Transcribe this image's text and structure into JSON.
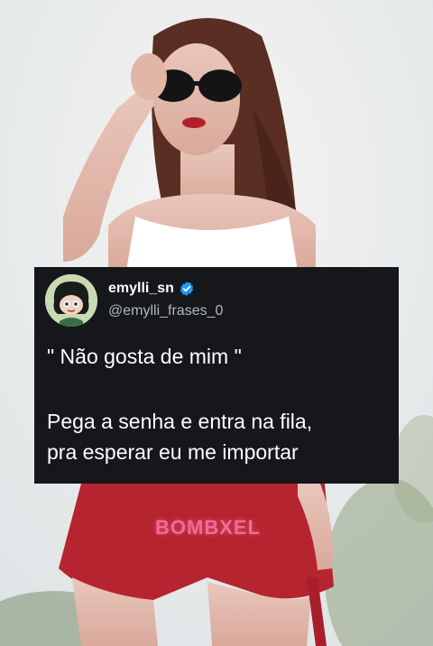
{
  "tweet": {
    "username": "emylli_sn",
    "handle": "@emylli_frases_0",
    "verified": true,
    "lines": [
      "\" Não gosta de mim \"",
      "Pega a senha e entra na fila,",
      "pra esperar eu me importar"
    ]
  },
  "watermark": {
    "text": "BOMBXEL",
    "color": "#f06a9a"
  },
  "colors": {
    "card_background": "#15171b",
    "verified_badge": "#1d9bf0",
    "shorts": "#b5242f"
  },
  "icons": [
    "verified-badge-icon"
  ]
}
